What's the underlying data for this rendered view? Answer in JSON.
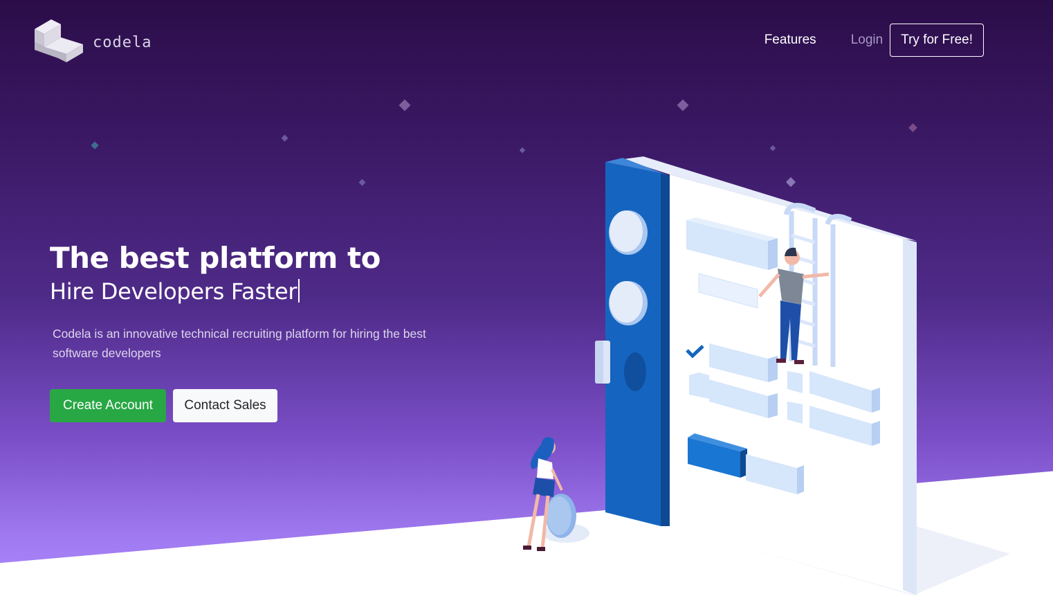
{
  "brand": {
    "name": "codela",
    "logo_icon": "cube-logo-icon"
  },
  "nav": {
    "features_label": "Features",
    "login_label": "Login",
    "try_label": "Try for Free!"
  },
  "hero": {
    "headline": "The best platform to",
    "subheadline": "Hire Developers Faster",
    "description": "Codela is an innovative technical recruiting platform for hiring the best software developers",
    "create_label": "Create Account",
    "contact_label": "Contact Sales"
  },
  "colors": {
    "bg_top": "#2b0d49",
    "bg_bottom": "#b28cff",
    "primary_green": "#28a745",
    "accent_blue": "#1565c0"
  }
}
